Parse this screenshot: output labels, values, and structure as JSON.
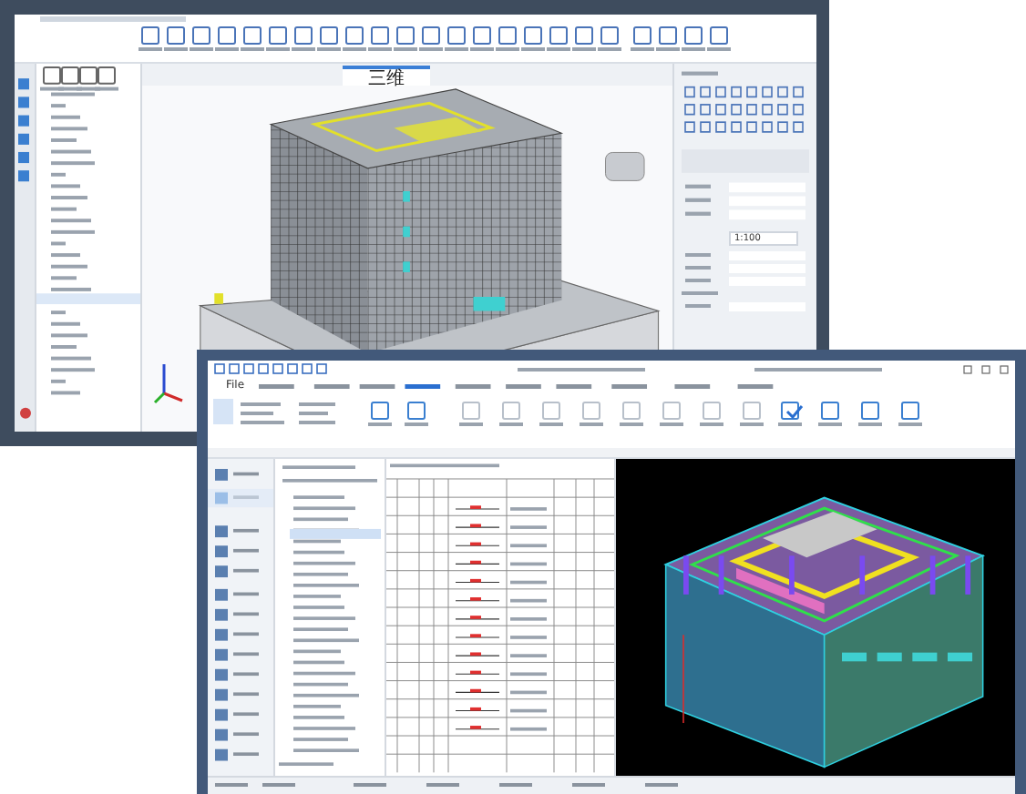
{
  "back_window": {
    "view_tab": {
      "label": "三维",
      "selected": true
    },
    "scale_field": {
      "value": "1:100"
    }
  },
  "front_window": {
    "menu": [
      {
        "label": "File",
        "selected": false
      }
    ]
  }
}
